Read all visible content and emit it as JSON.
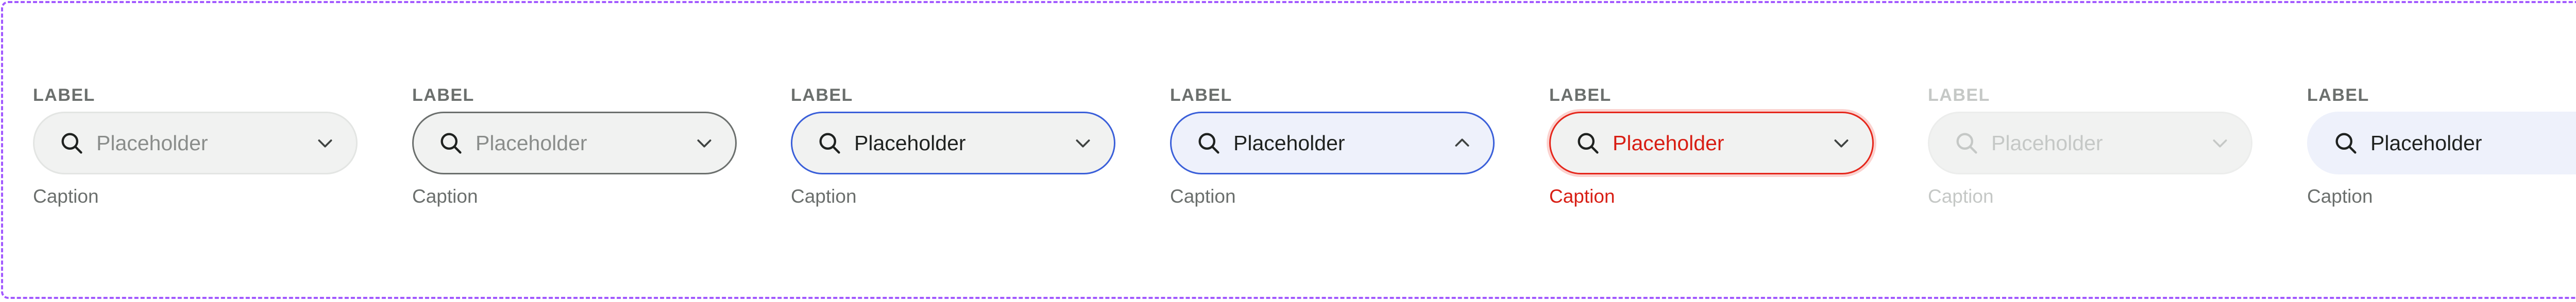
{
  "fields": [
    {
      "state": "default",
      "label": "LABEL",
      "value": "Placeholder",
      "caption": "Caption",
      "chevron": "chevron-down-icon"
    },
    {
      "state": "hover",
      "label": "LABEL",
      "value": "Placeholder",
      "caption": "Caption",
      "chevron": "chevron-down-icon"
    },
    {
      "state": "focus",
      "label": "LABEL",
      "value": "Placeholder",
      "caption": "Caption",
      "chevron": "chevron-down-icon"
    },
    {
      "state": "open",
      "label": "LABEL",
      "value": "Placeholder",
      "caption": "Caption",
      "chevron": "chevron-up-icon"
    },
    {
      "state": "error",
      "label": "LABEL",
      "value": "Placeholder",
      "caption": "Caption",
      "chevron": "chevron-down-icon"
    },
    {
      "state": "disabled",
      "label": "LABEL",
      "value": "Placeholder",
      "caption": "Caption",
      "chevron": "chevron-down-icon"
    },
    {
      "state": "selected",
      "label": "LABEL",
      "value": "Placeholder",
      "caption": "Caption",
      "chevron": "chevron-up-icon"
    }
  ],
  "colors": {
    "frame_border": "#a259ff",
    "field_bg": "#f1f2f1",
    "focus_border": "#3a5fd9",
    "open_bg": "#eef1fb",
    "error": "#e5261b",
    "text": "#1f2220",
    "muted": "#6b6f6d",
    "disabled": "#c5c8c6"
  }
}
